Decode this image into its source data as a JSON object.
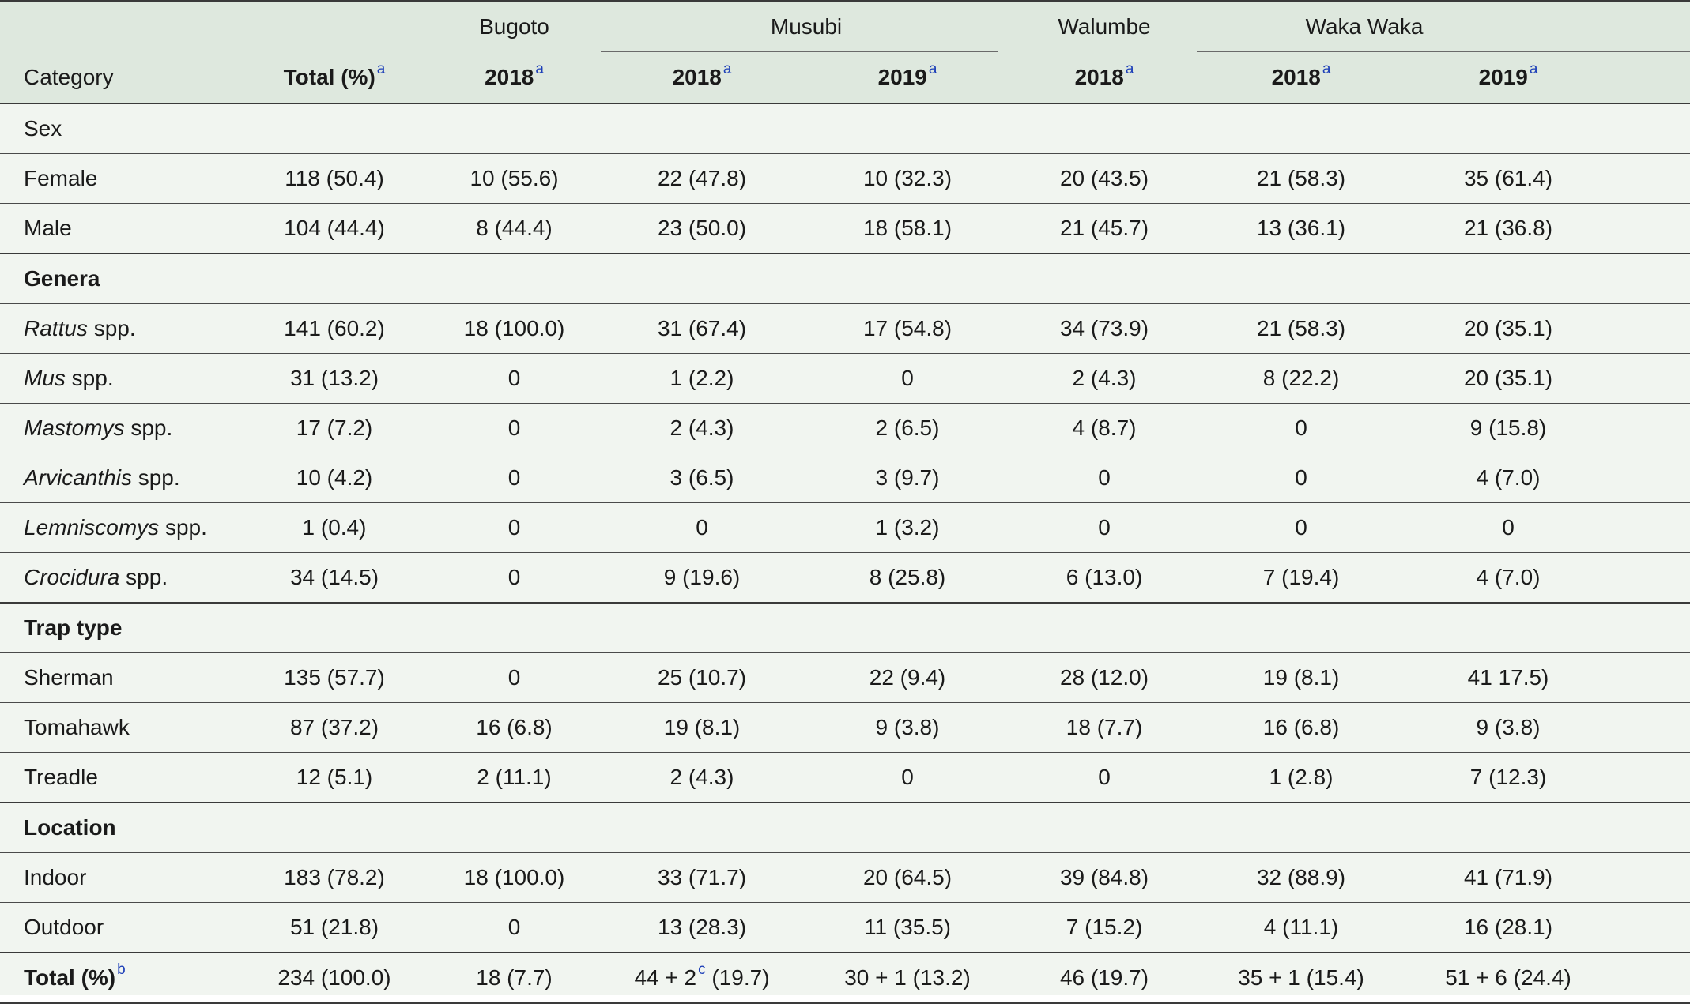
{
  "header": {
    "category_label": "Category",
    "total_label": "Total (%)",
    "total_footnote": "a",
    "sites": [
      "Bugoto",
      "Musubi",
      "Walumbe",
      "Waka Waka"
    ],
    "years": [
      {
        "label": "2018",
        "fn": "a"
      },
      {
        "label": "2018",
        "fn": "a"
      },
      {
        "label": "2019",
        "fn": "a"
      },
      {
        "label": "2018",
        "fn": "a"
      },
      {
        "label": "2018",
        "fn": "a"
      },
      {
        "label": "2019",
        "fn": "a"
      }
    ]
  },
  "sections": {
    "sex": "Sex",
    "genera": "Genera",
    "trap_type": "Trap type",
    "location": "Location"
  },
  "rows": {
    "female": {
      "label": "Female",
      "values": [
        "118 (50.4)",
        "10 (55.6)",
        "22 (47.8)",
        "10 (32.3)",
        "20 (43.5)",
        "21 (58.3)",
        "35 (61.4)"
      ]
    },
    "male": {
      "label": "Male",
      "values": [
        "104 (44.4)",
        "8 (44.4)",
        "23 (50.0)",
        "18 (58.1)",
        "21 (45.7)",
        "13 (36.1)",
        "21 (36.8)"
      ]
    },
    "rattus": {
      "genus": "Rattus",
      "suffix": " spp.",
      "values": [
        "141 (60.2)",
        "18 (100.0)",
        "31 (67.4)",
        "17 (54.8)",
        "34 (73.9)",
        "21 (58.3)",
        "20 (35.1)"
      ]
    },
    "mus": {
      "genus": "Mus",
      "suffix": " spp.",
      "values": [
        "31 (13.2)",
        "0",
        "1 (2.2)",
        "0",
        "2 (4.3)",
        "8 (22.2)",
        "20 (35.1)"
      ]
    },
    "mastomys": {
      "genus": "Mastomys",
      "suffix": " spp.",
      "values": [
        "17 (7.2)",
        "0",
        "2 (4.3)",
        "2 (6.5)",
        "4 (8.7)",
        "0",
        "9 (15.8)"
      ]
    },
    "arvicanthis": {
      "genus": "Arvicanthis",
      "suffix": " spp.",
      "values": [
        "10 (4.2)",
        "0",
        "3 (6.5)",
        "3 (9.7)",
        "0",
        "0",
        "4 (7.0)"
      ]
    },
    "lemniscomys": {
      "genus": "Lemniscomys",
      "suffix": " spp.",
      "values": [
        "1 (0.4)",
        "0",
        "0",
        "1 (3.2)",
        "0",
        "0",
        "0"
      ]
    },
    "crocidura": {
      "genus": "Crocidura",
      "suffix": " spp.",
      "values": [
        "34 (14.5)",
        "0",
        "9 (19.6)",
        "8 (25.8)",
        "6 (13.0)",
        "7 (19.4)",
        "4 (7.0)"
      ]
    },
    "sherman": {
      "label": "Sherman",
      "values": [
        "135 (57.7)",
        "0",
        "25 (10.7)",
        "22 (9.4)",
        "28 (12.0)",
        "19 (8.1)",
        "41 17.5)"
      ]
    },
    "tomahawk": {
      "label": "Tomahawk",
      "values": [
        "87 (37.2)",
        "16 (6.8)",
        "19 (8.1)",
        "9 (3.8)",
        "18 (7.7)",
        "16 (6.8)",
        "9 (3.8)"
      ]
    },
    "treadle": {
      "label": "Treadle",
      "values": [
        "12 (5.1)",
        "2 (11.1)",
        "2 (4.3)",
        "0",
        "0",
        "1 (2.8)",
        "7 (12.3)"
      ]
    },
    "indoor": {
      "label": "Indoor",
      "values": [
        "183 (78.2)",
        "18 (100.0)",
        "33 (71.7)",
        "20 (64.5)",
        "39 (84.8)",
        "32 (88.9)",
        "41 (71.9)"
      ]
    },
    "outdoor": {
      "label": "Outdoor",
      "values": [
        "51 (21.8)",
        "0",
        "13 (28.3)",
        "11 (35.5)",
        "7 (15.2)",
        "4 (11.1)",
        "16 (28.1)"
      ]
    }
  },
  "total_row": {
    "label": "Total (%)",
    "footnote": "b",
    "total": "234 (100.0)",
    "bugoto_2018": "18 (7.7)",
    "musubi_2018_pre": "44 + 2",
    "musubi_2018_fn": "c",
    "musubi_2018_post": " (19.7)",
    "musubi_2019": "30 + 1 (13.2)",
    "walumbe_2018": "46 (19.7)",
    "waka_2018": "35 + 1 (15.4)",
    "waka_2019": "51 + 6 (24.4)"
  },
  "colors": {
    "header_bg": "#dee8de",
    "body_bg": "#f1f5f0",
    "footnote_link": "#1d3fb8",
    "rule": "#3a3a3a"
  }
}
